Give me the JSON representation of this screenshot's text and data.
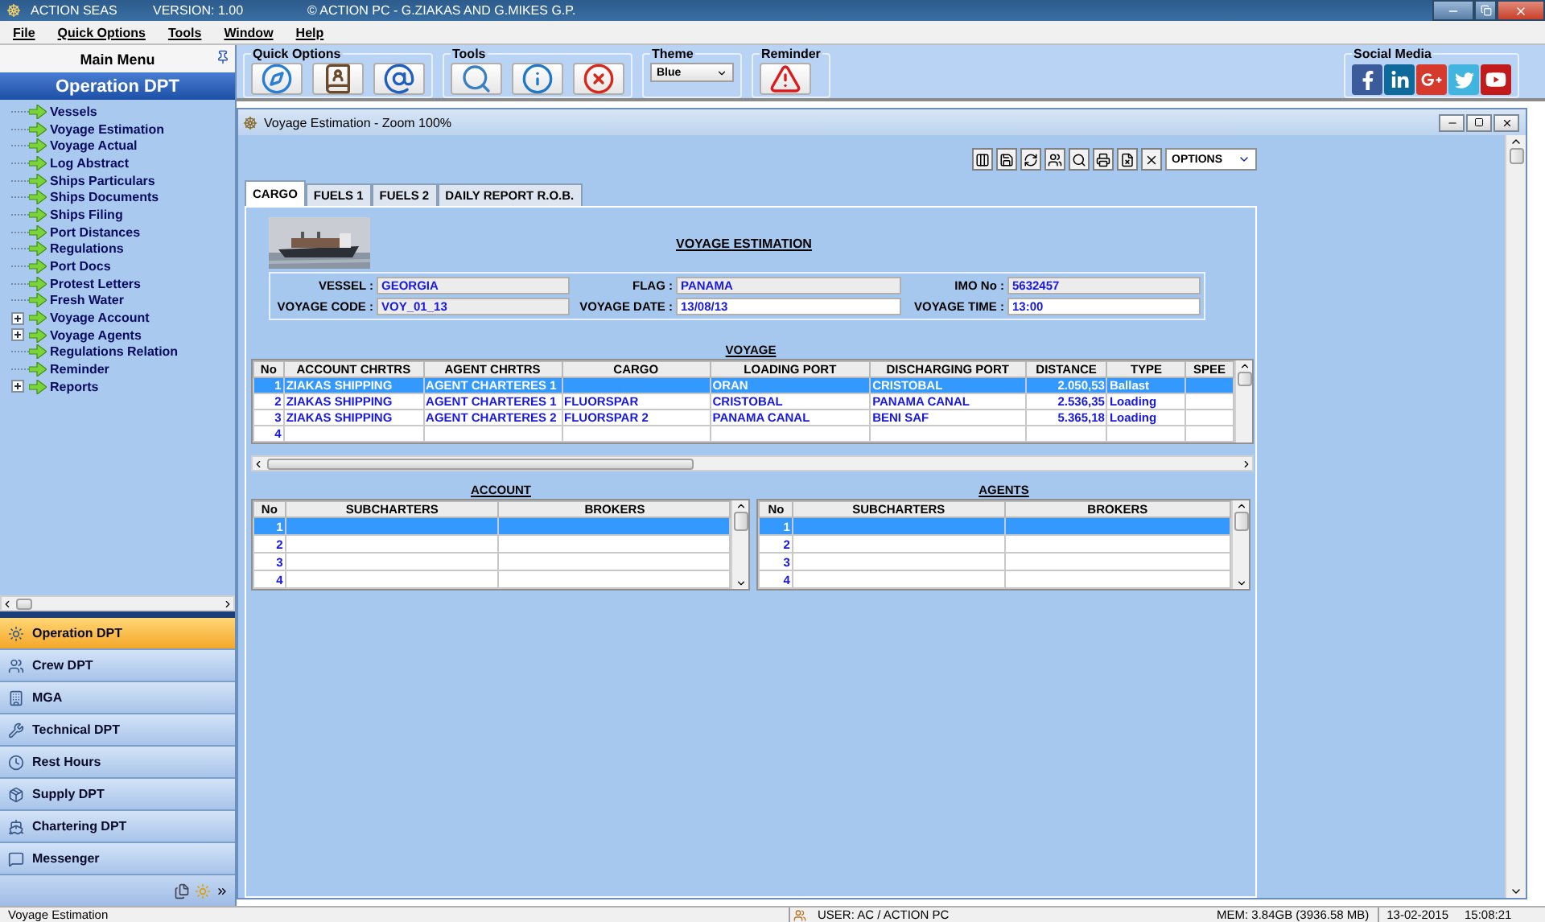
{
  "app": {
    "name": "ACTION SEAS",
    "version": "VERSION: 1.00",
    "copyright": "© ACTION PC  -  G.ZIAKAS AND G.MIKES G.P."
  },
  "menu": [
    "File",
    "Quick Options",
    "Tools",
    "Window",
    "Help"
  ],
  "sidebar": {
    "header": "Main Menu",
    "section": "Operation DPT",
    "items": [
      {
        "label": "Vessels",
        "expandable": false
      },
      {
        "label": "Voyage Estimation",
        "expandable": false
      },
      {
        "label": "Voyage Actual",
        "expandable": false
      },
      {
        "label": "Log Abstract",
        "expandable": false
      },
      {
        "label": "Ships Particulars",
        "expandable": false
      },
      {
        "label": "Ships Documents",
        "expandable": false
      },
      {
        "label": "Ships Filing",
        "expandable": false
      },
      {
        "label": "Port Distances",
        "expandable": false
      },
      {
        "label": "Regulations",
        "expandable": false
      },
      {
        "label": "Port Docs",
        "expandable": false
      },
      {
        "label": "Protest Letters",
        "expandable": false
      },
      {
        "label": "Fresh Water",
        "expandable": false
      },
      {
        "label": "Voyage Account",
        "expandable": true
      },
      {
        "label": "Voyage Agents",
        "expandable": true
      },
      {
        "label": "Regulations Relation",
        "expandable": false
      },
      {
        "label": "Reminder",
        "expandable": false
      },
      {
        "label": "Reports",
        "expandable": true
      }
    ],
    "departments": [
      {
        "label": "Operation DPT",
        "selected": true
      },
      {
        "label": "Crew DPT",
        "selected": false
      },
      {
        "label": "MGA",
        "selected": false
      },
      {
        "label": "Technical DPT",
        "selected": false
      },
      {
        "label": "Rest Hours",
        "selected": false
      },
      {
        "label": "Supply DPT",
        "selected": false
      },
      {
        "label": "Chartering DPT",
        "selected": false
      },
      {
        "label": "Messenger",
        "selected": false
      }
    ]
  },
  "toolbar": {
    "quick_options": "Quick Options",
    "tools": "Tools",
    "theme": {
      "title": "Theme",
      "value": "Blue"
    },
    "reminder": "Reminder",
    "social": "Social Media"
  },
  "child": {
    "title": "Voyage Estimation - Zoom 100%",
    "options": "OPTIONS",
    "tabs": [
      {
        "label": "CARGO",
        "selected": true
      },
      {
        "label": "FUELS 1",
        "selected": false
      },
      {
        "label": "FUELS 2",
        "selected": false
      },
      {
        "label": "DAILY REPORT R.O.B.",
        "selected": false
      }
    ],
    "heading": "VOYAGE ESTIMATION",
    "fields": [
      {
        "label": "VESSEL :",
        "value": "GEORGIA",
        "editable": false
      },
      {
        "label": "FLAG :",
        "value": "PANAMA",
        "editable": false
      },
      {
        "label": "IMO No :",
        "value": "5632457",
        "editable": false
      },
      {
        "label": "VOYAGE CODE :",
        "value": "VOY_01_13",
        "editable": false
      },
      {
        "label": "VOYAGE DATE :",
        "value": "13/08/13",
        "editable": true
      },
      {
        "label": "VOYAGE TIME :",
        "value": "13:00",
        "editable": true
      }
    ],
    "voyage": {
      "title": "VOYAGE",
      "columns": [
        "No",
        "ACCOUNT CHRTRS",
        "AGENT CHRTRS",
        "CARGO",
        "LOADING PORT",
        "DISCHARGING PORT",
        "DISTANCE",
        "TYPE",
        "SPEE"
      ],
      "rows": [
        {
          "selected": true,
          "cells": [
            "1",
            "ZIAKAS SHIPPING",
            "AGENT CHARTERES 1",
            null,
            "ORAN",
            "CRISTOBAL",
            "2.050,53",
            "Ballast",
            null
          ]
        },
        {
          "selected": false,
          "cells": [
            "2",
            "ZIAKAS SHIPPING",
            "AGENT CHARTERES 1",
            "FLUORSPAR",
            "CRISTOBAL",
            "PANAMA CANAL",
            "2.536,35",
            "Loading",
            null
          ]
        },
        {
          "selected": false,
          "cells": [
            "3",
            "ZIAKAS SHIPPING",
            "AGENT CHARTERES 2",
            "FLUORSPAR 2",
            "PANAMA CANAL",
            "BENI SAF",
            "5.365,18",
            "Loading",
            null
          ]
        },
        {
          "selected": false,
          "cells": [
            "4",
            null,
            null,
            null,
            null,
            null,
            null,
            null,
            null
          ]
        }
      ]
    },
    "account": {
      "title": "ACCOUNT",
      "columns": [
        "No",
        "SUBCHARTERS",
        "BROKERS"
      ],
      "rows": [
        {
          "no": "1",
          "selected": true
        },
        {
          "no": "2",
          "selected": false
        },
        {
          "no": "3",
          "selected": false
        },
        {
          "no": "4",
          "selected": false
        }
      ]
    },
    "agents": {
      "title": "AGENTS",
      "columns": [
        "No",
        "SUBCHARTERS",
        "BROKERS"
      ],
      "rows": [
        {
          "no": "1",
          "selected": true
        },
        {
          "no": "2",
          "selected": false
        },
        {
          "no": "3",
          "selected": false
        },
        {
          "no": "4",
          "selected": false
        }
      ]
    }
  },
  "status_bar": {
    "left": "Voyage Estimation",
    "user": "USER: AC / ACTION PC",
    "memory": "MEM: 3.84GB (3936.58 MB)",
    "date": "13-02-2015",
    "time": "15:08:21"
  }
}
